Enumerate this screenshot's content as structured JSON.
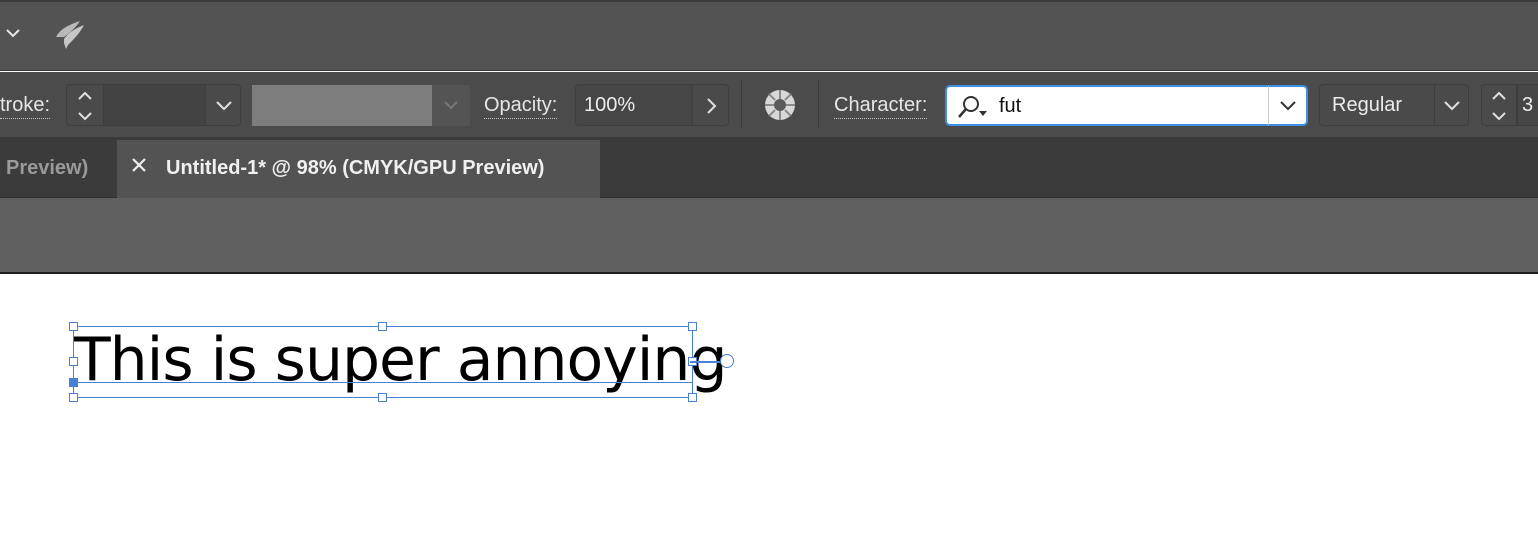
{
  "control_bar": {
    "stroke_label": "troke:",
    "opacity_label": "Opacity:",
    "opacity_value": "100%",
    "character_label": "Character:",
    "font_search_value": "fut",
    "font_style_value": "Regular",
    "font_size_partial": "3"
  },
  "tabs": [
    {
      "label": "Preview)",
      "active": false
    },
    {
      "label": "Untitled-1* @ 98% (CMYK/GPU Preview)",
      "active": true
    }
  ],
  "canvas": {
    "text_content": "This is super annoying"
  },
  "colors": {
    "focus_accent": "#3d8fe3",
    "selection": "#4a7fd6",
    "panel_bg": "#535353"
  },
  "icons": [
    "chevron-down-icon",
    "brush-icon",
    "stepper-icon",
    "chevron-right-icon",
    "globe-icon",
    "search-icon",
    "close-icon"
  ]
}
